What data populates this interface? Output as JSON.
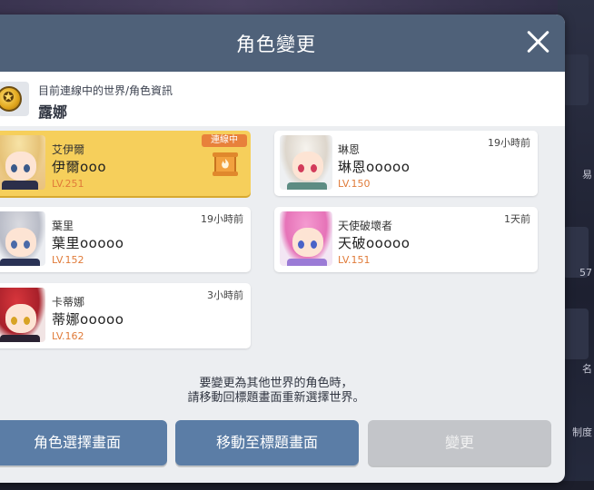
{
  "dialog": {
    "title": "角色變更"
  },
  "current_world": {
    "label": "目前連線中的世界/角色資訊",
    "name": "露娜"
  },
  "characters": [
    {
      "job": "艾伊爾",
      "name": "伊爾ooo",
      "level": "LV.251",
      "time": "",
      "online_badge": "連線中",
      "active": true
    },
    {
      "job": "琳恩",
      "name": "琳恩ooooo",
      "level": "LV.150",
      "time": "19小時前",
      "active": false
    },
    {
      "job": "葉里",
      "name": "葉里ooooo",
      "level": "LV.152",
      "time": "19小時前",
      "active": false
    },
    {
      "job": "天使破壞者",
      "name": "天破ooooo",
      "level": "LV.151",
      "time": "1天前",
      "active": false
    },
    {
      "job": "卡蒂娜",
      "name": "蒂娜ooooo",
      "level": "LV.162",
      "time": "3小時前",
      "active": false
    }
  ],
  "notice": {
    "line1": "要變更為其他世界的角色時，",
    "line2": "請移動回標題畫面重新選擇世界。"
  },
  "buttons": {
    "character_select": "角色選擇畫面",
    "title_screen": "移動至標題畫面",
    "change": "變更"
  },
  "background": {
    "right_chip_1": "易",
    "right_chip_2": "57",
    "right_chip_3": "名",
    "right_chip_4": "制度"
  },
  "colors": {
    "header": "#4f6179",
    "active_card": "#f6cf5b",
    "level_text": "#e07b39",
    "online_badge": "#e8813b",
    "primary_button": "#5b7da6",
    "disabled_button": "#c3c5c9"
  }
}
